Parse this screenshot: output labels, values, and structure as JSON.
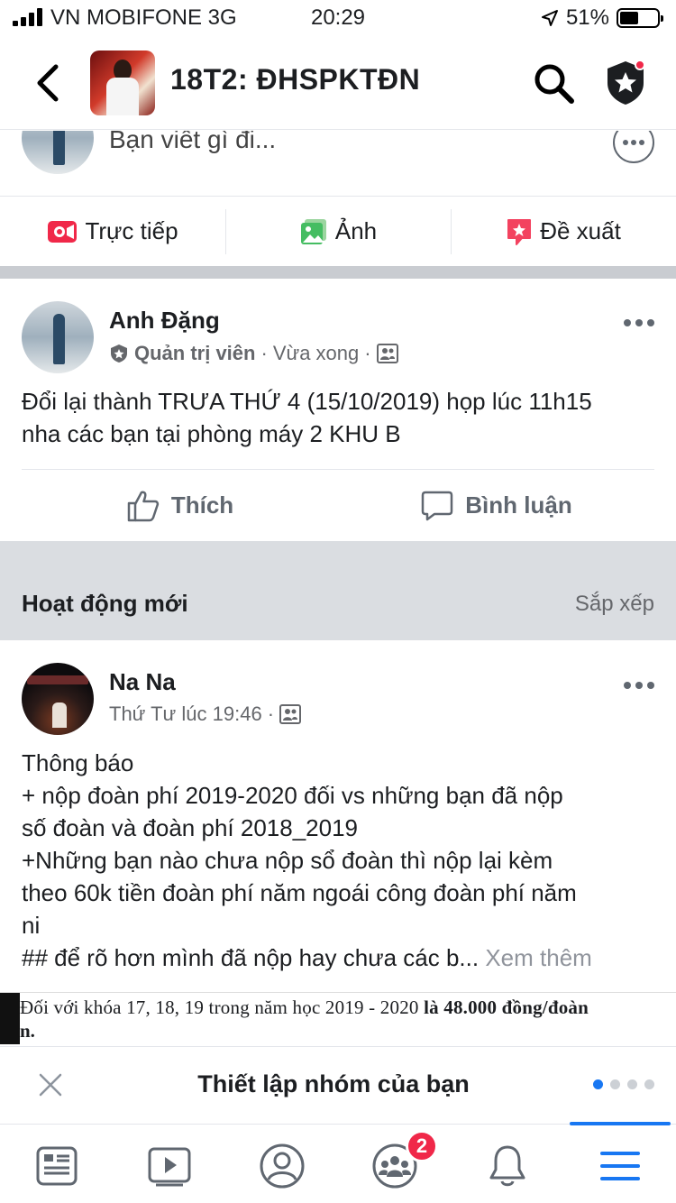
{
  "status_bar": {
    "carrier": "VN MOBIFONE  3G",
    "time": "20:29",
    "battery": "51%",
    "battery_level": 0.51
  },
  "header": {
    "group_name": "18T2: ĐHSPKTĐN",
    "icons": [
      "back-icon",
      "search-icon",
      "admin-shield-icon"
    ]
  },
  "composer": {
    "placeholder": "Bạn viết gì đi...",
    "actions": [
      {
        "label": "Trực tiếp",
        "icon": "live-video-icon",
        "color": "#f02849"
      },
      {
        "label": "Ảnh",
        "icon": "photo-icon",
        "color": "#45bd62"
      },
      {
        "label": "Đề xuất",
        "icon": "recommendation-icon",
        "color": "#f3425f"
      }
    ]
  },
  "pinned_post": {
    "author": "Anh Đặng",
    "role": "Quản trị viên",
    "time": "Vừa xong",
    "text_lines": [
      "Đổi lại thành TRƯA THỨ 4 (15/10/2019) họp lúc 11h15",
      "nha các bạn tại phòng máy 2 KHU B"
    ],
    "like_label": "Thích",
    "comment_label": "Bình luận"
  },
  "activity_section": {
    "title": "Hoạt động mới",
    "sort_label": "Sắp xếp"
  },
  "feed_post": {
    "author": "Na Na",
    "time": "Thứ Tư lúc 19:46",
    "text_lines": [
      "Thông báo",
      "+ nộp đoàn phí 2019-2020 đối vs những bạn đã nộp",
      "số đoàn và đoàn phí 2018_2019",
      "+Những bạn nào chưa nộp sổ đoàn thì nộp lại kèm",
      "theo 60k tiền đoàn phí năm ngoái công đoàn phí năm",
      "ni"
    ],
    "truncated_line": "## để rõ hơn mình đã nộp hay chưa các b...",
    "see_more": "Xem thêm",
    "attachment_text": "Đối với khóa 17, 18, 19 trong năm học 2019 - 2020",
    "attachment_bold": "là 48.000 đồng/đoàn",
    "attachment_line2": "n."
  },
  "setup_banner": {
    "text": "Thiết lập nhóm của bạn",
    "pages": 4,
    "current_page": 1
  },
  "tab_bar": {
    "tabs": [
      "news-feed-icon",
      "watch-icon",
      "profile-icon",
      "groups-icon",
      "notifications-icon",
      "menu-icon"
    ],
    "groups_badge": "2",
    "active": "menu-icon",
    "accent": "#1877f2"
  }
}
